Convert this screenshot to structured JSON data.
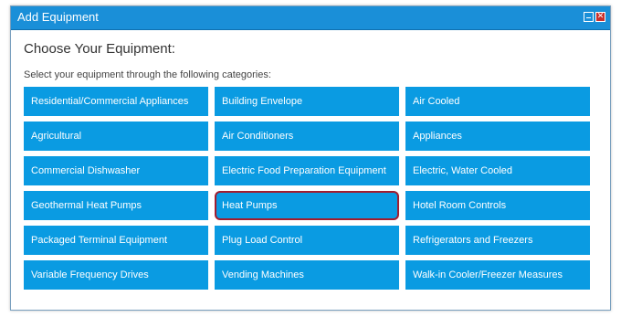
{
  "dialog": {
    "title": "Add Equipment",
    "heading": "Choose Your Equipment:",
    "subtitle": "Select your equipment through the following categories:",
    "categories": [
      "Residential/Commercial Appliances",
      "Building Envelope",
      "Air Cooled",
      "Agricultural",
      "Air Conditioners",
      "Appliances",
      "Commercial Dishwasher",
      "Electric Food Preparation Equipment",
      "Electric, Water Cooled",
      "Geothermal Heat Pumps",
      "Heat Pumps",
      "Hotel Room Controls",
      "Packaged Terminal Equipment",
      "Plug Load Control",
      "Refrigerators and Freezers",
      "Variable Frequency Drives",
      "Vending Machines",
      "Walk-in Cooler/Freezer Measures"
    ],
    "highlighted_category": "Heat Pumps"
  },
  "colors": {
    "titlebar": "#1a8fd8",
    "button": "#0a9be2",
    "highlight_border": "#a11d2f",
    "close_button": "#c9302c"
  },
  "icons": {
    "minimize": "minimize-icon",
    "close": "close-icon"
  }
}
